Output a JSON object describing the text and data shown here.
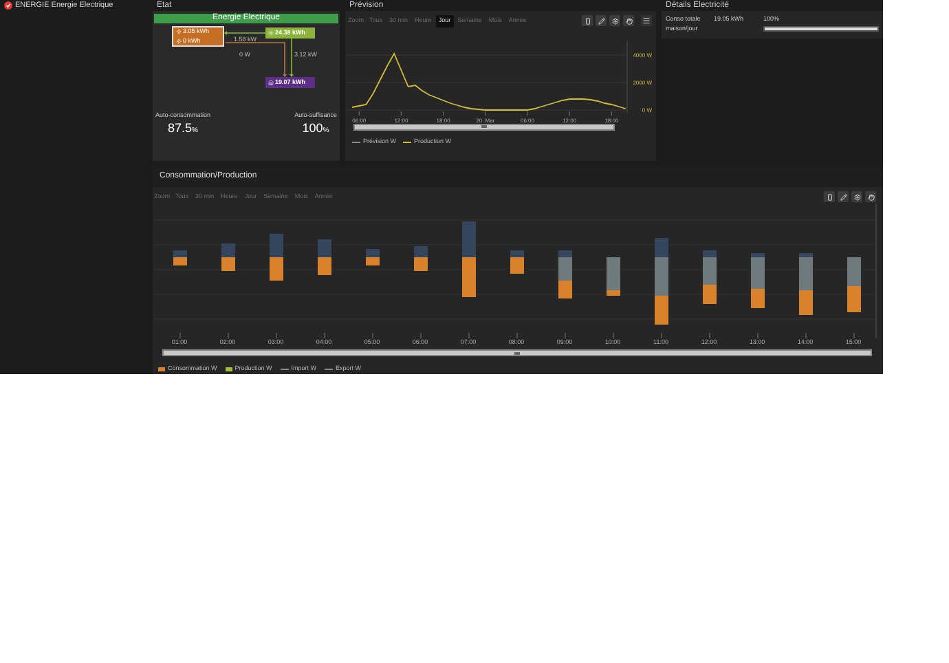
{
  "header": {
    "title": "ENERGIE Energie Electrique"
  },
  "etat": {
    "title": "Etat",
    "banner": "Energie Electrique",
    "grid_import": "3.05 kWh",
    "grid_export": "0 kWh",
    "solar": "24.38 kWh",
    "house": "19.07 kWh",
    "flow_solar_grid": "1.58 kW",
    "flow_grid_house": "0 W",
    "flow_solar_house": "3.12 kW",
    "stats": [
      {
        "label": "Auto-consommation",
        "value": "87.5",
        "unit": "%"
      },
      {
        "label": "Auto-suffisance",
        "value": "100",
        "unit": "%"
      }
    ]
  },
  "prevision": {
    "title": "Prévision",
    "zoom_label": "Zoom",
    "zoom_options": [
      {
        "label": "Tous",
        "selected": false
      },
      {
        "label": "30 min",
        "selected": false
      },
      {
        "label": "Heure",
        "selected": false
      },
      {
        "label": "Jour",
        "selected": true
      },
      {
        "label": "Semaine",
        "selected": false
      },
      {
        "label": "Mois",
        "selected": false
      },
      {
        "label": "Année",
        "selected": false
      }
    ],
    "chart_data": {
      "type": "line",
      "ylim": [
        -200,
        5000
      ],
      "categories": [
        null,
        "06:00",
        null,
        null,
        null,
        null,
        null,
        "12:00",
        null,
        null,
        null,
        null,
        null,
        "18:00",
        null,
        null,
        null,
        null,
        null,
        "20. Mar",
        null,
        null,
        null,
        null,
        null,
        "06:00",
        null,
        null,
        null,
        null,
        null,
        "12:00",
        null,
        null,
        null,
        null,
        null,
        "18:00",
        null,
        null
      ],
      "series": [
        {
          "name": "Prévision W",
          "color": "#8c8c8c",
          "values": [
            null,
            null,
            null,
            null,
            null,
            null,
            null,
            null,
            null,
            null,
            null,
            null,
            null,
            null,
            null,
            null,
            null,
            null,
            null,
            null,
            null,
            null,
            null,
            null,
            null,
            null,
            null,
            null,
            null,
            null,
            null,
            null,
            null,
            null,
            null,
            null,
            null,
            null,
            null,
            null
          ]
        },
        {
          "name": "Production W",
          "color": "#d4bd3a",
          "values": [
            200,
            300,
            400,
            1200,
            2200,
            3200,
            4100,
            2900,
            1700,
            1800,
            1400,
            1100,
            900,
            700,
            500,
            350,
            200,
            100,
            50,
            0,
            0,
            0,
            0,
            0,
            0,
            0,
            100,
            250,
            400,
            550,
            700,
            800,
            800,
            800,
            750,
            650,
            500,
            400,
            250,
            100
          ]
        }
      ],
      "yticks": [
        {
          "value": 0,
          "label": "0 W"
        },
        {
          "value": 2000,
          "label": "2000 W"
        },
        {
          "value": 4000,
          "label": "4000 W"
        }
      ]
    }
  },
  "details": {
    "title": "Détails Electricité",
    "rows": [
      {
        "label": "Conso totale maison/jour",
        "value": "19.05 kWh",
        "percent": "100%",
        "level": 1
      }
    ]
  },
  "conso": {
    "title": "Consommation/Production",
    "zoom_label": "Zoom",
    "zoom_options": [
      {
        "label": "Tous",
        "selected": false
      },
      {
        "label": "30 min",
        "selected": false
      },
      {
        "label": "Heure",
        "selected": false
      },
      {
        "label": "Jour",
        "selected": false
      },
      {
        "label": "Semaine",
        "selected": false
      },
      {
        "label": "Mois",
        "selected": false
      },
      {
        "label": "Année",
        "selected": false
      }
    ],
    "x_labels": [
      "01:00",
      "02:00",
      "03:00",
      "04:00",
      "05:00",
      "06:00",
      "07:00",
      "08:00",
      "09:00",
      "10:00",
      "11:00",
      "12:00",
      "13:00",
      "14:00",
      "15:00"
    ],
    "legend": [
      {
        "label": "Consommation W",
        "color": "#d9822b",
        "kind": "box"
      },
      {
        "label": "Production W",
        "color": "#9bbf3b",
        "kind": "box"
      },
      {
        "label": "Import W",
        "color": "#8a8a8a",
        "kind": "line"
      },
      {
        "label": "Export W",
        "color": "#8a8a8a",
        "kind": "line"
      }
    ]
  }
}
